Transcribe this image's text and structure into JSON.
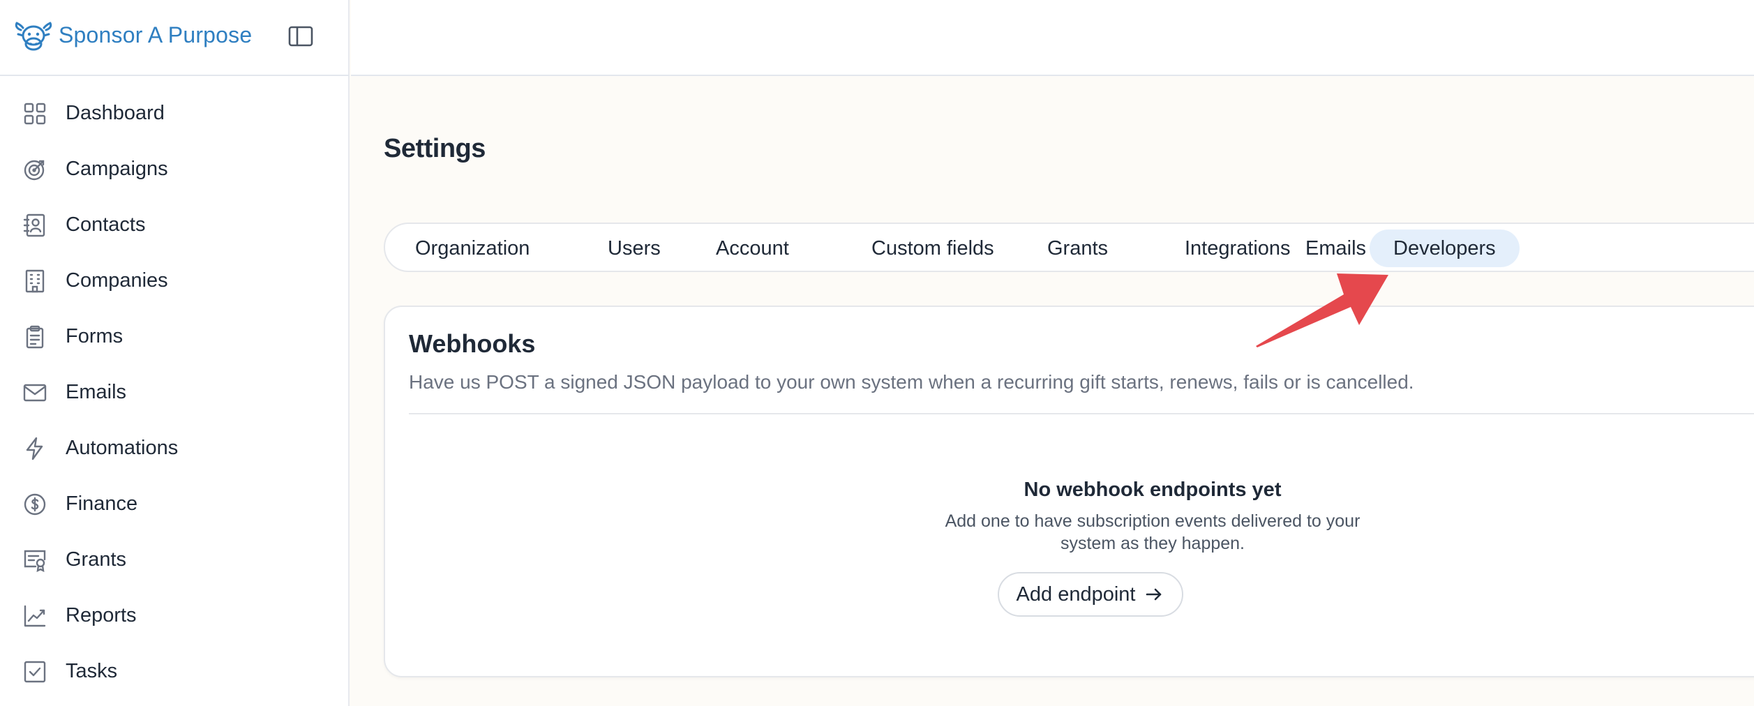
{
  "brand": {
    "name": "Sponsor A Purpose"
  },
  "sidebar": {
    "items": [
      {
        "label": "Dashboard",
        "icon": "grid-icon"
      },
      {
        "label": "Campaigns",
        "icon": "target-icon"
      },
      {
        "label": "Contacts",
        "icon": "contact-book-icon"
      },
      {
        "label": "Companies",
        "icon": "building-icon"
      },
      {
        "label": "Forms",
        "icon": "clipboard-icon"
      },
      {
        "label": "Emails",
        "icon": "mail-icon"
      },
      {
        "label": "Automations",
        "icon": "lightning-icon"
      },
      {
        "label": "Finance",
        "icon": "dollar-circle-icon"
      },
      {
        "label": "Grants",
        "icon": "certificate-icon"
      },
      {
        "label": "Reports",
        "icon": "line-chart-icon"
      },
      {
        "label": "Tasks",
        "icon": "checkbox-icon"
      }
    ]
  },
  "page": {
    "title": "Settings"
  },
  "tabs": [
    {
      "label": "Organization"
    },
    {
      "label": "Users"
    },
    {
      "label": "Account"
    },
    {
      "label": "Custom fields"
    },
    {
      "label": "Grants"
    },
    {
      "label": "Integrations"
    },
    {
      "label": "Emails"
    },
    {
      "label": "Developers",
      "active": true
    }
  ],
  "webhooks": {
    "title": "Webhooks",
    "description": "Have us POST a signed JSON payload to your own system when a recurring gift starts, renews, fails or is cancelled.",
    "empty_title": "No webhook endpoints yet",
    "empty_description": "Add one to have subscription events delivered to your system as they happen.",
    "add_button_label": "Add endpoint"
  },
  "colors": {
    "brand": "#2f7fc1",
    "active_tab_bg": "#e4effb",
    "annotation_arrow": "#e5484d",
    "page_bg": "#fdfbf7"
  }
}
